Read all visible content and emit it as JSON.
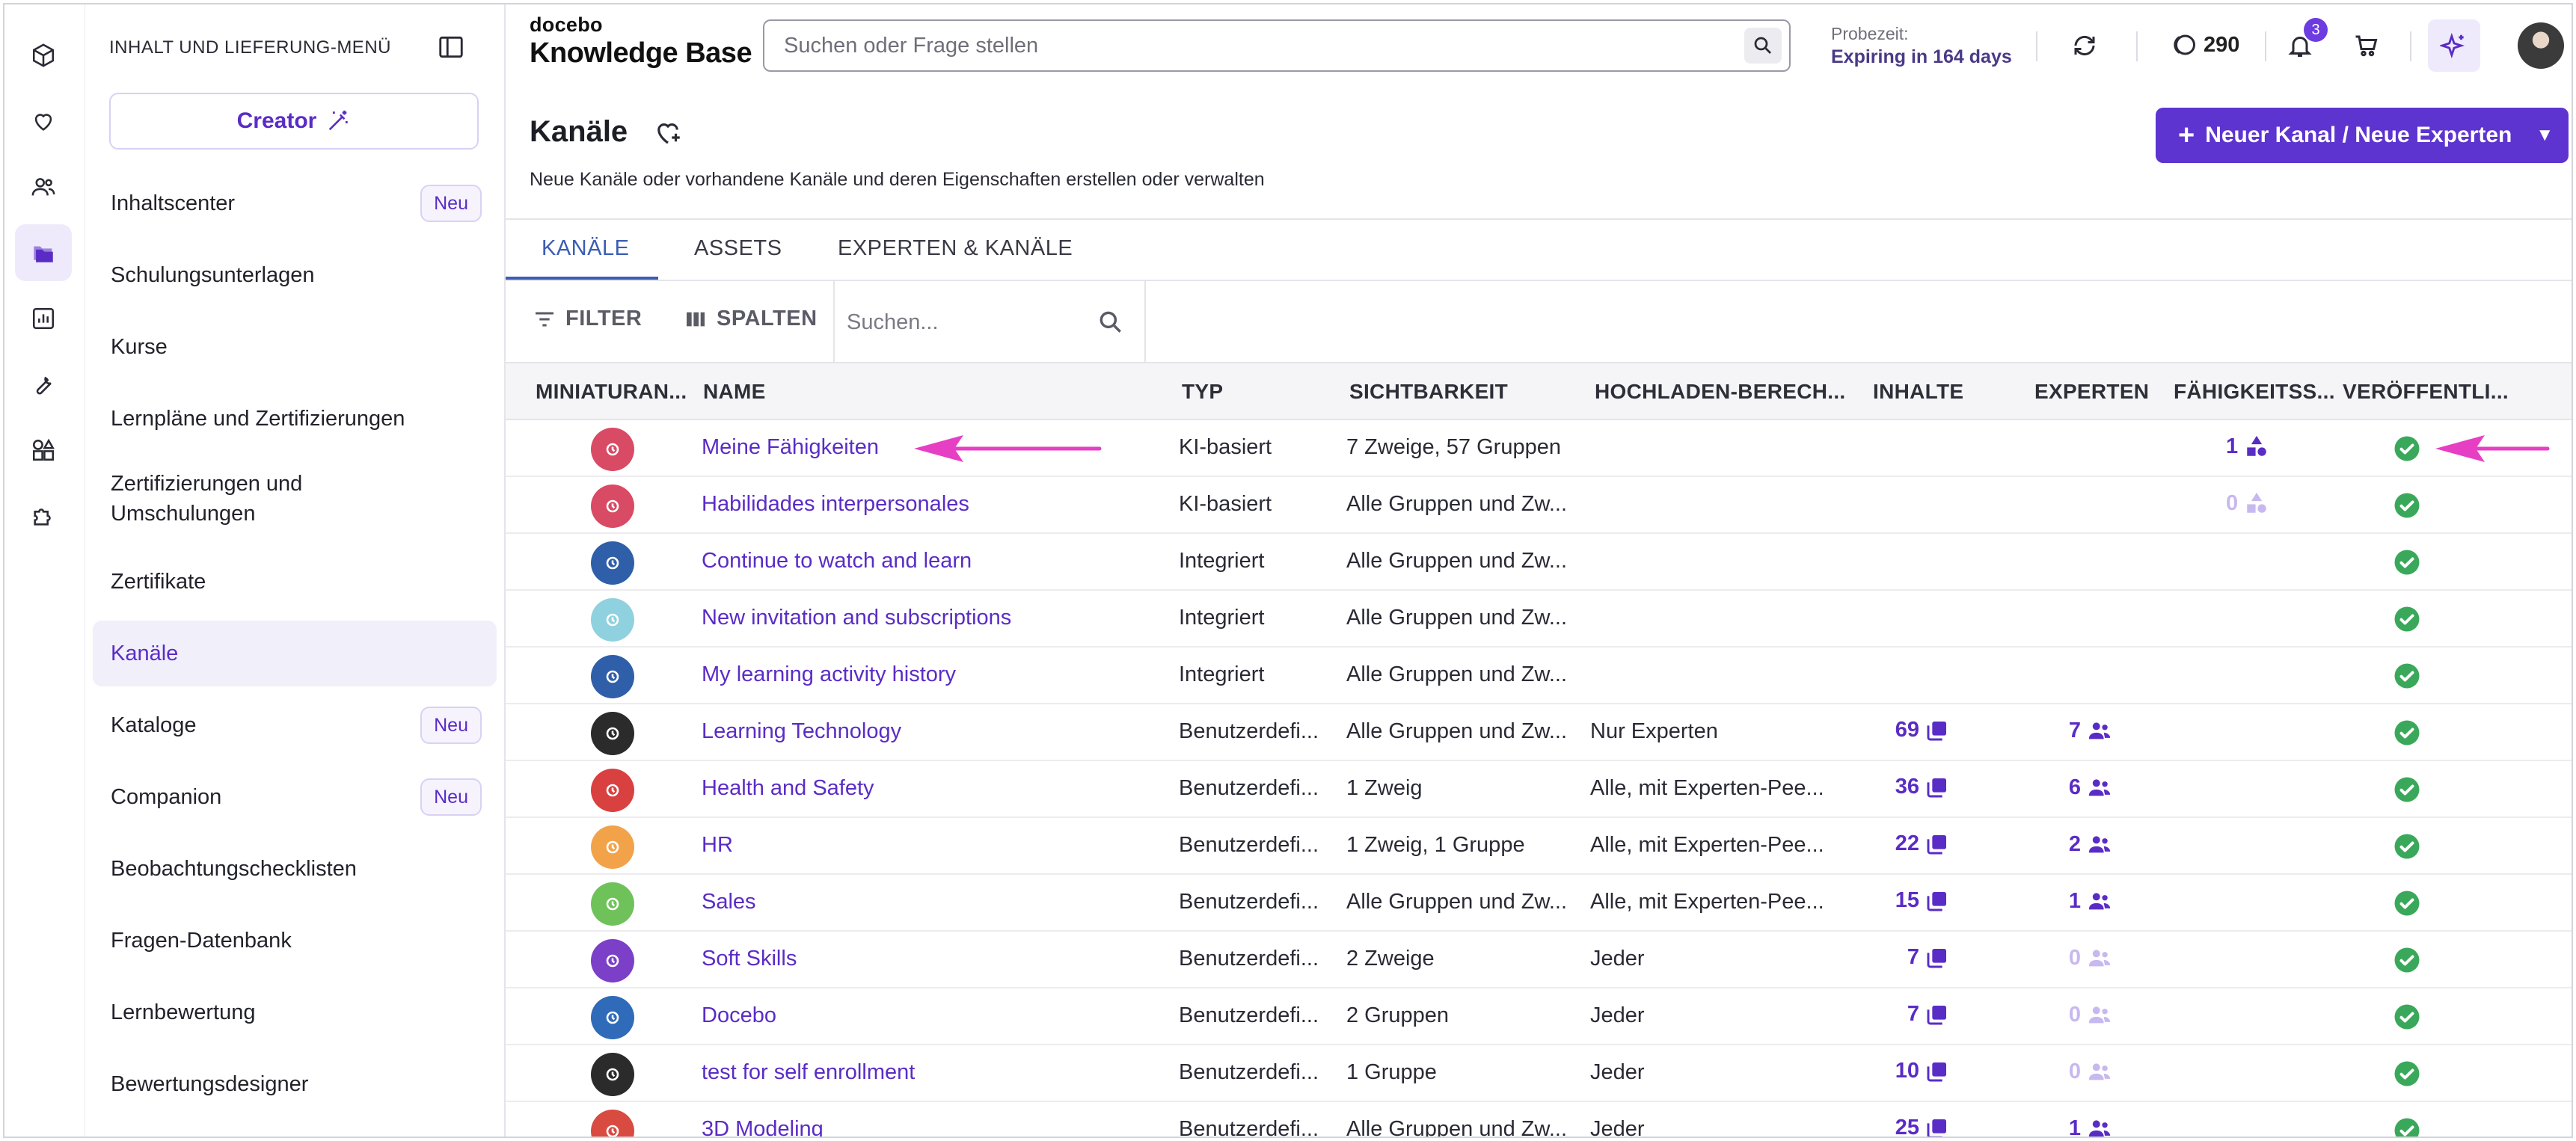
{
  "app": {
    "brand_small": "docebo",
    "brand_big": "Knowledge Base",
    "search_placeholder": "Suchen oder Frage stellen",
    "trial_label": "Probezeit:",
    "trial_value": "Expiring in 164 days",
    "coins": "290",
    "notifications": "3"
  },
  "rail": {
    "icons": [
      "cube-icon",
      "heart-icon",
      "users-icon",
      "folders-icon",
      "chart-icon",
      "wrench-icon",
      "apps-icon",
      "puzzle-icon"
    ]
  },
  "menu": {
    "title": "INHALT UND LIEFERUNG-MENÜ",
    "creator_label": "Creator",
    "items": [
      {
        "label": "Inhaltscenter",
        "badge": "Neu"
      },
      {
        "label": "Schulungsunterlagen"
      },
      {
        "label": "Kurse"
      },
      {
        "label": "Lernpläne und Zertifizierungen"
      },
      {
        "label": "Zertifizierungen und Umschulungen"
      },
      {
        "label": "Zertifikate"
      },
      {
        "label": "Kanäle"
      },
      {
        "label": "Kataloge",
        "badge": "Neu"
      },
      {
        "label": "Companion",
        "badge": "Neu"
      },
      {
        "label": "Beobachtungschecklisten"
      },
      {
        "label": "Fragen-Datenbank"
      },
      {
        "label": "Lernbewertung"
      },
      {
        "label": "Bewertungsdesigner"
      }
    ]
  },
  "page": {
    "title": "Kanäle",
    "subtitle": "Neue Kanäle oder vorhandene Kanäle und deren Eigenschaften erstellen oder verwalten",
    "new_button": "Neuer Kanal / Neue Experten"
  },
  "tabs": [
    "KANÄLE",
    "ASSETS",
    "EXPERTEN & KANÄLE"
  ],
  "toolbar": {
    "filter": "FILTER",
    "columns": "SPALTEN",
    "search_placeholder": "Suchen..."
  },
  "table": {
    "headers": [
      "MINIATURAN...",
      "NAME",
      "TYP",
      "SICHTBARKEIT",
      "HOCHLADEN-BERECH...",
      "INHALTE",
      "EXPERTEN",
      "FÄHIGKEITSS...",
      "VERÖFFENTLI..."
    ],
    "rows": [
      {
        "thumb": "#d94a64",
        "name": "Meine Fähigkeiten",
        "type": "KI-basiert",
        "visibility": "7 Zweige, 57 Gruppen",
        "upload": "",
        "content": "",
        "experts": "",
        "skills": "1",
        "skills_faded": false
      },
      {
        "thumb": "#d94a64",
        "name": "Habilidades interpersonales",
        "type": "KI-basiert",
        "visibility": "Alle Gruppen und Zw...",
        "upload": "",
        "content": "",
        "experts": "",
        "skills": "0",
        "skills_faded": true
      },
      {
        "thumb": "#2f5fa8",
        "name": "Continue to watch and learn",
        "type": "Integriert",
        "visibility": "Alle Gruppen und Zw...",
        "upload": "",
        "content": "",
        "experts": "",
        "skills": ""
      },
      {
        "thumb": "#8fd1de",
        "name": "New invitation and subscriptions",
        "type": "Integriert",
        "visibility": "Alle Gruppen und Zw...",
        "upload": "",
        "content": "",
        "experts": "",
        "skills": ""
      },
      {
        "thumb": "#2f5fa8",
        "name": "My learning activity history",
        "type": "Integriert",
        "visibility": "Alle Gruppen und Zw...",
        "upload": "",
        "content": "",
        "experts": "",
        "skills": ""
      },
      {
        "thumb": "#2b2b2b",
        "name": "Learning Technology",
        "type": "Benutzerdefi...",
        "visibility": "Alle Gruppen und Zw...",
        "upload": "Nur Experten",
        "content": "69",
        "experts": "7",
        "experts_faded": false,
        "skills": ""
      },
      {
        "thumb": "#d94040",
        "name": "Health and Safety",
        "type": "Benutzerdefi...",
        "visibility": "1 Zweig",
        "upload": "Alle, mit Experten-Pee...",
        "content": "36",
        "experts": "6",
        "experts_faded": false,
        "skills": ""
      },
      {
        "thumb": "#f2a34a",
        "name": "HR",
        "type": "Benutzerdefi...",
        "visibility": "1 Zweig, 1 Gruppe",
        "upload": "Alle, mit Experten-Pee...",
        "content": "22",
        "experts": "2",
        "experts_faded": false,
        "skills": ""
      },
      {
        "thumb": "#6fc25a",
        "name": "Sales",
        "type": "Benutzerdefi...",
        "visibility": "Alle Gruppen und Zw...",
        "upload": "Alle, mit Experten-Pee...",
        "content": "15",
        "experts": "1",
        "experts_faded": false,
        "skills": ""
      },
      {
        "thumb": "#7b3fc8",
        "name": "Soft Skills",
        "type": "Benutzerdefi...",
        "visibility": "2 Zweige",
        "upload": "Jeder",
        "content": "7",
        "experts": "0",
        "experts_faded": true,
        "skills": ""
      },
      {
        "thumb": "#2f6bb8",
        "name": "Docebo",
        "type": "Benutzerdefi...",
        "visibility": "2 Gruppen",
        "upload": "Jeder",
        "content": "7",
        "experts": "0",
        "experts_faded": true,
        "skills": ""
      },
      {
        "thumb": "#2b2b2b",
        "name": "test for self enrollment",
        "type": "Benutzerdefi...",
        "visibility": "1 Gruppe",
        "upload": "Jeder",
        "content": "10",
        "experts": "0",
        "experts_faded": true,
        "skills": ""
      },
      {
        "thumb": "#d94a40",
        "name": "3D Modeling",
        "type": "Benutzerdefi...",
        "visibility": "Alle Gruppen und Zw...",
        "upload": "Jeder",
        "content": "25",
        "experts": "1",
        "experts_faded": false,
        "skills": ""
      }
    ]
  },
  "colors": {
    "accent": "#5a2cc6",
    "tab_active": "#3b5db3",
    "published": "#3aa85a",
    "annotation_arrow": "#e63fc4"
  }
}
